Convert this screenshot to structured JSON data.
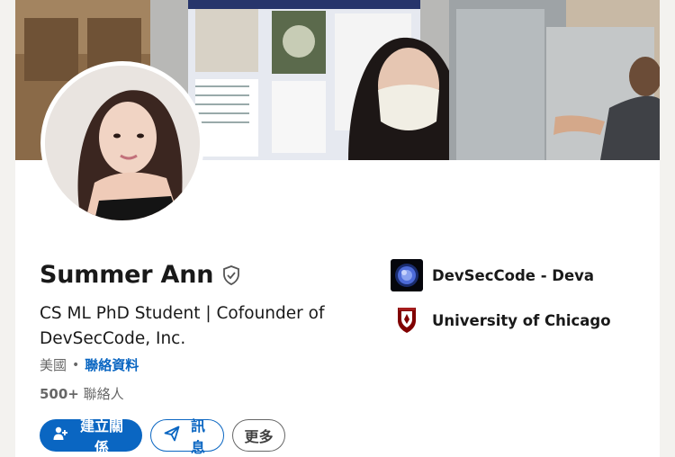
{
  "profile": {
    "name": "Summer Ann",
    "headline": "CS ML PhD Student | Cofounder of DevSecCode, Inc.",
    "location": "美國",
    "contact_info_label": "聯絡資料",
    "connections_count": "500+",
    "connections_label": "聯絡人"
  },
  "actions": {
    "connect_label": "建立關係",
    "message_label": "訊息",
    "more_label": "更多"
  },
  "organizations": [
    {
      "name": "DevSecCode - Deva",
      "logo": "devseccode-logo"
    },
    {
      "name": "University of Chicago",
      "logo": "uchicago-phoenix-crest"
    }
  ],
  "colors": {
    "brand_blue": "#0a66c2",
    "uchicago_maroon": "#800000"
  },
  "icons": {
    "verified": "shield-check-icon",
    "connect": "person-add-icon",
    "message": "send-icon"
  }
}
